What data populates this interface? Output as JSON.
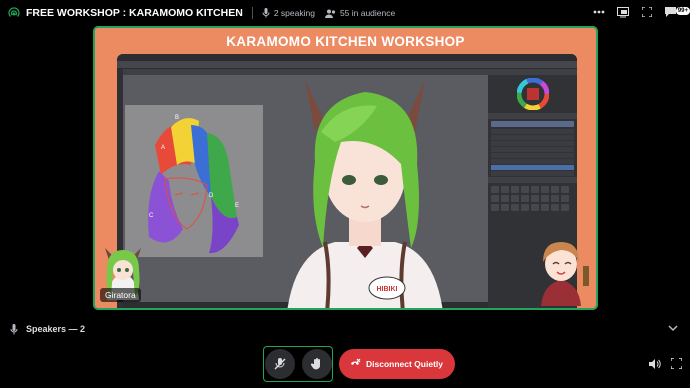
{
  "header": {
    "title": "FREE WORKSHOP : KARAMOMO KITCHEN",
    "speaking": "2 speaking",
    "audience": "55 in audience",
    "chat_badge": "99+"
  },
  "stream": {
    "workshop_title": "KARAMOMO KITCHEN WORKSHOP",
    "presenter_name": "Giratora",
    "badge_text": "HIBIKI",
    "sketch_letters": [
      "B",
      "A",
      "C",
      "D",
      "E"
    ]
  },
  "speakers": {
    "label": "Speakers — 2"
  },
  "controls": {
    "disconnect_label": "Disconnect Quietly"
  },
  "colors": {
    "accent_green": "#23a559",
    "disconnect_red": "#da373c",
    "stream_bg": "#ec8a61"
  }
}
